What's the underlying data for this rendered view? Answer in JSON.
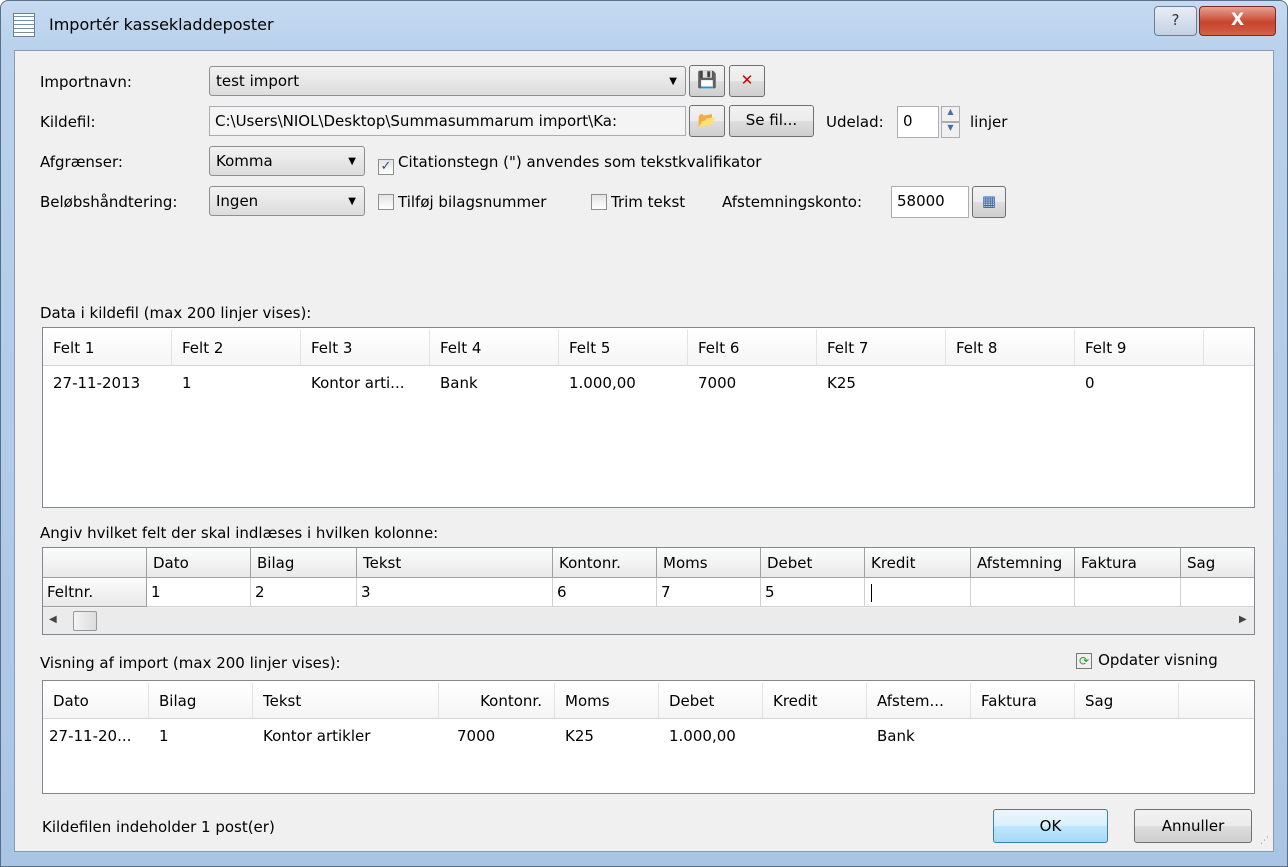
{
  "window": {
    "title": "Importér kassekladdeposter",
    "help": "?",
    "close": "X"
  },
  "form": {
    "importnavn_label": "Importnavn:",
    "importnavn_value": "test import",
    "kildefil_label": "Kildefil:",
    "kildefil_value": "C:\\Users\\NIOL\\Desktop\\Summasummarum import\\Ka:",
    "se_fil": "Se fil...",
    "udelad_label": "Udelad:",
    "udelad_value": "0",
    "linjer": "linjer",
    "afgraenser_label": "Afgrænser:",
    "afgraenser_value": "Komma",
    "citation_label": "Citationstegn (\") anvendes som tekstkvalifikator",
    "citation_checked": true,
    "beloeb_label": "Beløbshåndtering:",
    "beloeb_value": "Ingen",
    "tilfoej_label": "Tilføj bilagsnummer",
    "tilfoej_checked": false,
    "trim_label": "Trim tekst",
    "trim_checked": false,
    "afstemning_label": "Afstemningskonto:",
    "afstemning_value": "58000"
  },
  "source": {
    "label": "Data i kildefil (max 200 linjer vises):",
    "columns": [
      "Felt 1",
      "Felt 2",
      "Felt 3",
      "Felt 4",
      "Felt 5",
      "Felt 6",
      "Felt 7",
      "Felt 8",
      "Felt 9"
    ],
    "rows": [
      [
        "27-11-2013",
        "1",
        "Kontor arti...",
        "Bank",
        "1.000,00",
        "7000",
        "K25",
        "",
        "0"
      ]
    ]
  },
  "mapping": {
    "label": "Angiv hvilket felt der skal indlæses i hvilken kolonne:",
    "row_header": "Feltnr.",
    "columns": [
      "Dato",
      "Bilag",
      "Tekst",
      "Kontonr.",
      "Moms",
      "Debet",
      "Kredit",
      "Afstemning",
      "Faktura",
      "Sag"
    ],
    "values": [
      "1",
      "2",
      "3",
      "6",
      "7",
      "5",
      "",
      "",
      "",
      ""
    ]
  },
  "preview": {
    "label": "Visning af import (max 200 linjer vises):",
    "refresh": "Opdater visning",
    "columns": [
      "Dato",
      "Bilag",
      "Tekst",
      "Kontonr.",
      "Moms",
      "Debet",
      "Kredit",
      "Afstem...",
      "Faktura",
      "Sag"
    ],
    "rows": [
      [
        "27-11-20...",
        "1",
        "Kontor artikler",
        "7000",
        "K25",
        "1.000,00",
        "",
        "Bank",
        "",
        ""
      ]
    ]
  },
  "footer": {
    "status": "Kildefilen indeholder 1 post(er)",
    "ok": "OK",
    "cancel": "Annuller"
  }
}
